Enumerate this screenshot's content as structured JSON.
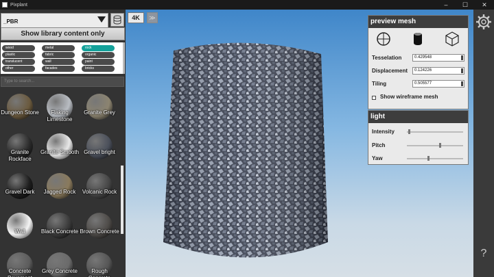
{
  "window": {
    "title": "Pixplant",
    "min": "–",
    "max": "☐",
    "close": "✕"
  },
  "library": {
    "selected": "_PBR",
    "show_content_label": "Show library content only",
    "search_placeholder": "Type to search...",
    "tags": [
      {
        "label": "wood",
        "active": false
      },
      {
        "label": "metal",
        "active": false
      },
      {
        "label": "rock",
        "active": true
      },
      {
        "label": "plastic",
        "active": false
      },
      {
        "label": "fabric",
        "active": false
      },
      {
        "label": "organic",
        "active": false
      },
      {
        "label": "translucent",
        "active": false
      },
      {
        "label": "wall",
        "active": false
      },
      {
        "label": "paint",
        "active": false
      },
      {
        "label": "other",
        "active": false
      },
      {
        "label": "facades",
        "active": false
      },
      {
        "label": "bricks",
        "active": false
      }
    ],
    "materials": [
      {
        "name": "Dungeon Stone",
        "color": "#6b5a3e"
      },
      {
        "name": "Flaking Limestone",
        "color": "#b9bdc3"
      },
      {
        "name": "Granite Grey",
        "color": "#8c8470"
      },
      {
        "name": "Granite Rockface",
        "color": "#2b2b2b"
      },
      {
        "name": "Granite Smooth",
        "color": "#e8e8e8"
      },
      {
        "name": "Gravel bright",
        "color": "#4a4f5a"
      },
      {
        "name": "Gravel Dark",
        "color": "#1d1d1d"
      },
      {
        "name": "Jagged Rock",
        "color": "#8a7a5c"
      },
      {
        "name": "Volcanic Rock",
        "color": "#454545"
      },
      {
        "name": "Wall",
        "color": "#f4f4f4"
      },
      {
        "name": "Black Concrete",
        "color": "#3a3a3a"
      },
      {
        "name": "Brown Concrete",
        "color": "#4d4a47"
      },
      {
        "name": "Concrete Pavement",
        "color": "#5c5c5c"
      },
      {
        "name": "Grey Concrete",
        "color": "#6a6a6a"
      },
      {
        "name": "Rough Concrete",
        "color": "#555555"
      }
    ]
  },
  "viewport": {
    "btn_4k": "4K",
    "btn_play": "≫"
  },
  "preview_mesh": {
    "title": "preview mesh",
    "tesselation_label": "Tesselation",
    "tesselation_value": "0.429548",
    "displacement_label": "Displacement",
    "displacement_value": "0.124226",
    "tiling_label": "Tiling",
    "tiling_value": "0.505577",
    "wireframe_label": "Show wireframe mesh"
  },
  "light": {
    "title": "light",
    "intensity_label": "Intensity",
    "intensity_value": 0.02,
    "pitch_label": "Pitch",
    "pitch_value": 0.6,
    "yaw_label": "Yaw",
    "yaw_value": 0.38
  },
  "sidebar": {
    "help": "?"
  }
}
